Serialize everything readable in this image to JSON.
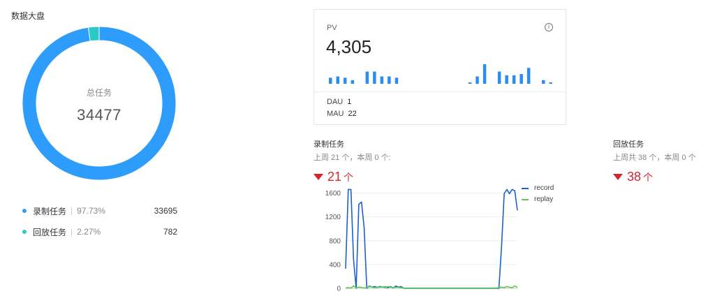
{
  "overview": {
    "title": "数据大盘",
    "center_label": "总任务",
    "center_value": "34477",
    "slices": [
      {
        "name": "录制任务",
        "percent": "97.73%",
        "value": "33695",
        "fraction": 0.9773,
        "color": "#2d9cfa"
      },
      {
        "name": "回放任务",
        "percent": "2.27%",
        "value": "782",
        "fraction": 0.0227,
        "color": "#2dc8c8"
      }
    ]
  },
  "pv_card": {
    "label": "PV",
    "info_icon": "info-icon",
    "value": "4,305",
    "mini_bars": [
      5,
      6,
      5,
      3,
      0,
      10,
      10,
      6,
      6,
      5,
      0,
      0,
      0,
      0,
      0,
      0,
      0,
      0,
      0,
      1,
      6,
      16,
      0,
      10,
      7,
      7,
      8,
      13,
      0,
      3,
      1
    ],
    "stats": [
      {
        "label": "DAU",
        "value": "1"
      },
      {
        "label": "MAU",
        "value": "22"
      }
    ]
  },
  "record_task": {
    "title": "录制任务",
    "subtitle": "上周 21 个，本周 0 个:",
    "change": "21",
    "unit": "个"
  },
  "replay_task": {
    "title": "回放任务",
    "subtitle": "上周共 38 个，本周 0 个",
    "change": "38",
    "unit": "个"
  },
  "chart_data": {
    "type": "line",
    "yticks": [
      0,
      400,
      800,
      1200,
      1600
    ],
    "ylim": [
      0,
      1700
    ],
    "x": [
      0,
      1,
      2,
      3,
      4,
      5,
      6,
      7,
      8,
      9,
      10,
      11,
      12,
      13,
      14,
      15,
      16,
      17,
      18,
      19,
      20,
      21,
      22,
      23,
      24,
      25,
      26,
      27,
      28,
      29,
      30,
      31,
      32,
      33,
      34,
      35,
      36,
      37,
      38,
      39,
      40,
      41,
      42,
      43,
      44,
      45,
      46,
      47,
      48,
      49,
      50,
      51,
      52,
      53,
      54,
      55,
      56,
      57,
      58,
      59,
      60,
      61,
      62,
      63,
      64,
      65
    ],
    "series": [
      {
        "name": "record",
        "color": "#1f5fc9",
        "values": [
          330,
          1660,
          1660,
          470,
          0,
          1410,
          1450,
          1020,
          0,
          40,
          20,
          30,
          15,
          30,
          20,
          25,
          10,
          30,
          5,
          40,
          20,
          30,
          0,
          0,
          0,
          0,
          0,
          0,
          0,
          0,
          0,
          0,
          0,
          0,
          0,
          0,
          0,
          0,
          0,
          0,
          0,
          0,
          0,
          0,
          0,
          0,
          0,
          0,
          0,
          0,
          0,
          0,
          0,
          0,
          0,
          0,
          0,
          0,
          0,
          700,
          1590,
          1660,
          1590,
          1660,
          1640,
          1310
        ]
      },
      {
        "name": "replay",
        "color": "#5ec64e",
        "values": [
          5,
          10,
          5,
          40,
          10,
          20,
          15,
          5,
          10,
          30,
          20,
          10,
          15,
          20,
          25,
          10,
          30,
          20,
          10,
          20,
          15,
          10,
          5,
          5,
          5,
          5,
          5,
          5,
          5,
          5,
          5,
          5,
          5,
          5,
          5,
          5,
          5,
          5,
          5,
          5,
          5,
          5,
          5,
          5,
          5,
          5,
          5,
          5,
          5,
          5,
          5,
          5,
          5,
          5,
          5,
          5,
          5,
          5,
          10,
          20,
          10,
          30,
          20,
          10,
          40,
          15
        ]
      }
    ]
  }
}
